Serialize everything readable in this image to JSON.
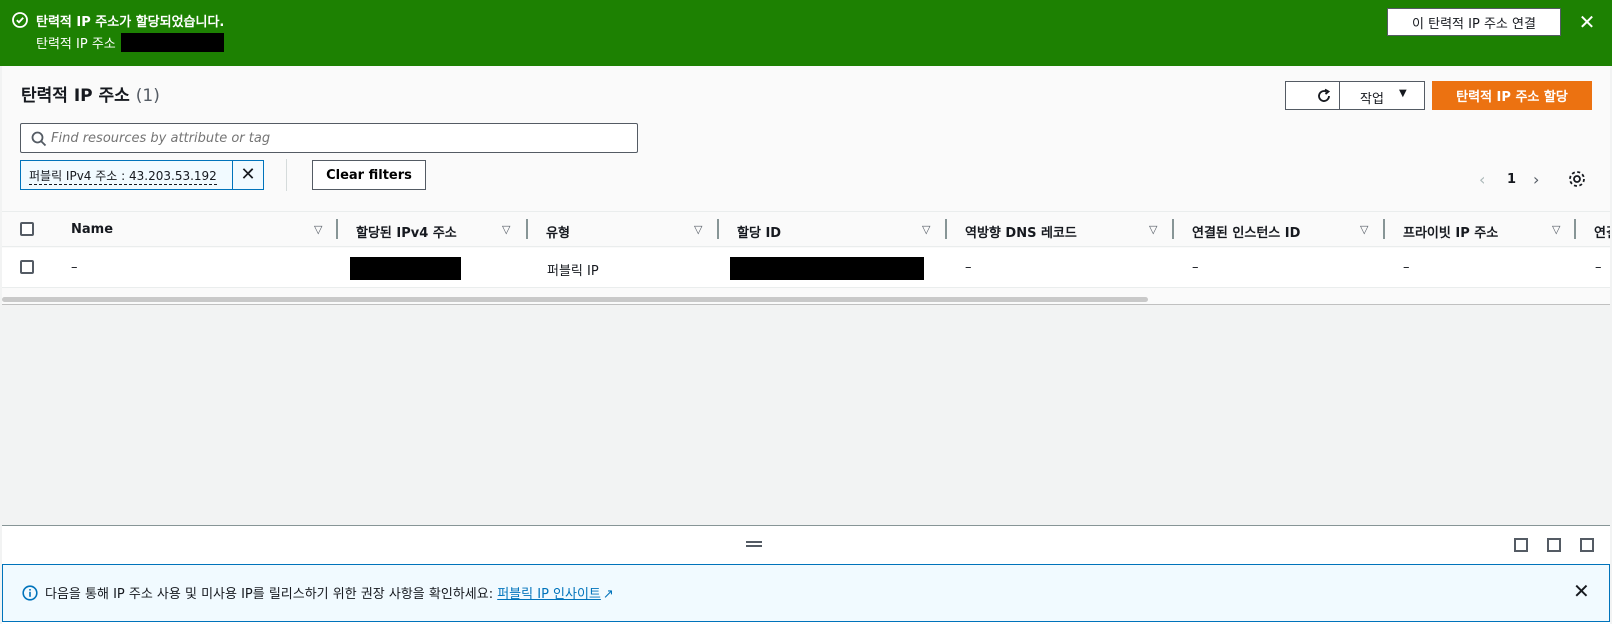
{
  "flash": {
    "title": "탄력적 IP 주소가 할당되었습니다.",
    "subtitle": "탄력적 IP 주소",
    "associate_button": "이 탄력적 IP 주소 연결",
    "close_glyph": "✕",
    "color": "#1d8102"
  },
  "panel": {
    "title": "탄력적 IP 주소",
    "count": "(1)",
    "actions_label": "작업",
    "actions_caret": "▼",
    "allocate_label": "탄력적 IP 주소 할당",
    "accent": "#ec7211"
  },
  "search": {
    "placeholder": "Find resources by attribute or tag"
  },
  "filter": {
    "token": "퍼블릭 IPv4 주소 : 43.203.53.192",
    "remove_glyph": "✕",
    "clear_label": "Clear filters"
  },
  "pagination": {
    "prev": "‹",
    "page": "1",
    "next": "›"
  },
  "table": {
    "columns": [
      "Name",
      "할당된 IPv4 주소",
      "유형",
      "할당 ID",
      "역방향 DNS 레코드",
      "연결된 인스턴스 ID",
      "프라이빗 IP 주소",
      "연결"
    ],
    "sort_glyph": "▽",
    "row": {
      "name": "–",
      "type": "퍼블릭 IP",
      "reverse_dns": "–",
      "instance_id": "–",
      "private_ip": "–",
      "extra": "–"
    }
  },
  "info": {
    "text": "다음을 통해 IP 주소 사용 및 미사용 IP를 릴리스하기 위한 권장 사항을 확인하세요:",
    "link": "퍼블릭 IP 인사이트",
    "close_glyph": "✕"
  }
}
